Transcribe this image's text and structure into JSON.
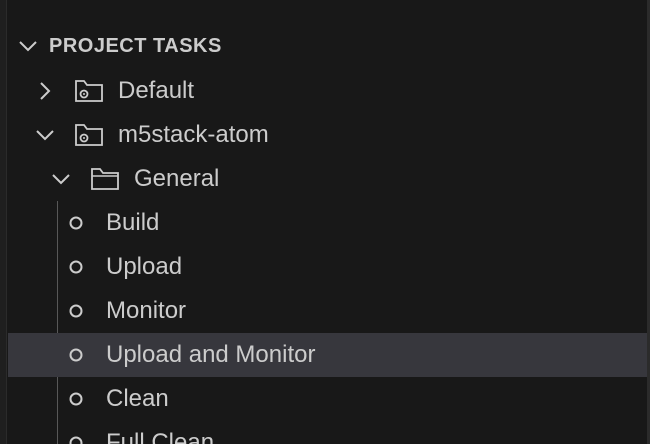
{
  "section": {
    "title": "PROJECT TASKS",
    "expanded": true
  },
  "tree": {
    "default_env": {
      "label": "Default",
      "icon": "project-folder-gear-icon",
      "expanded": false
    },
    "m5_env": {
      "label": "m5stack-atom",
      "icon": "project-folder-gear-icon",
      "expanded": true
    },
    "general_folder": {
      "label": "General",
      "icon": "folder-icon",
      "expanded": true
    },
    "tasks": [
      {
        "label": "Build",
        "icon": "circle-icon"
      },
      {
        "label": "Upload",
        "icon": "circle-icon"
      },
      {
        "label": "Monitor",
        "icon": "circle-icon"
      },
      {
        "label": "Upload and Monitor",
        "icon": "circle-icon",
        "selected": true
      },
      {
        "label": "Clean",
        "icon": "circle-icon"
      },
      {
        "label": "Full Clean",
        "icon": "circle-icon"
      }
    ]
  },
  "colors": {
    "background": "#181818",
    "selected_row": "#37373d",
    "text": "#cccccc",
    "guide_line": "#585858"
  }
}
